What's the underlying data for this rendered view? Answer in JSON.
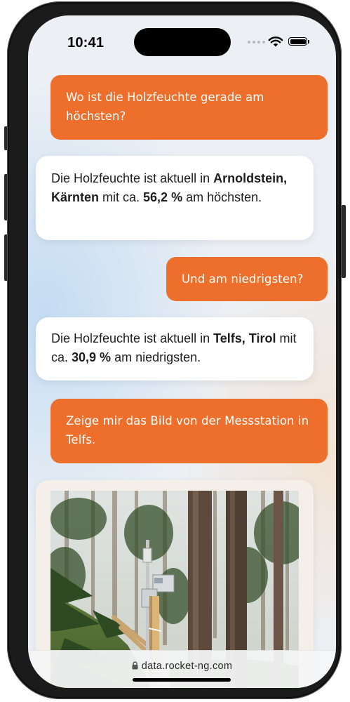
{
  "status_bar": {
    "time": "10:41"
  },
  "icons": {
    "signal": "signal-dots-icon",
    "wifi": "wifi-icon",
    "battery": "battery-icon",
    "lock": "lock-icon"
  },
  "colors": {
    "user_bubble": "#ee6f2c",
    "bot_bubble": "#ffffff",
    "url_bar": "#f4f5f7"
  },
  "chat": {
    "messages": [
      {
        "role": "user",
        "text": "Wo ist die Holzfeuchte gerade am höchsten?"
      },
      {
        "role": "assistant",
        "intro": "Die Holzfeuchte ist aktuell in ",
        "location": "Arnoldstein, Kärnten",
        "mid": " mit ca. ",
        "value": "56,2 %",
        "outro": " am höchsten."
      },
      {
        "role": "user",
        "text": "Und am niedrigsten?"
      },
      {
        "role": "assistant",
        "intro": "Die Holzfeuchte ist aktuell in ",
        "location": "Telfs, Tirol",
        "mid": " mit ca. ",
        "value": "30,9 %",
        "outro": " am niedrigsten."
      },
      {
        "role": "user",
        "text": "Zeige mir das Bild von der Messstation in Telfs."
      }
    ],
    "photo": {
      "subject": "measuring-station-telfs-forest"
    }
  },
  "browser": {
    "url": "data.rocket-ng.com"
  }
}
